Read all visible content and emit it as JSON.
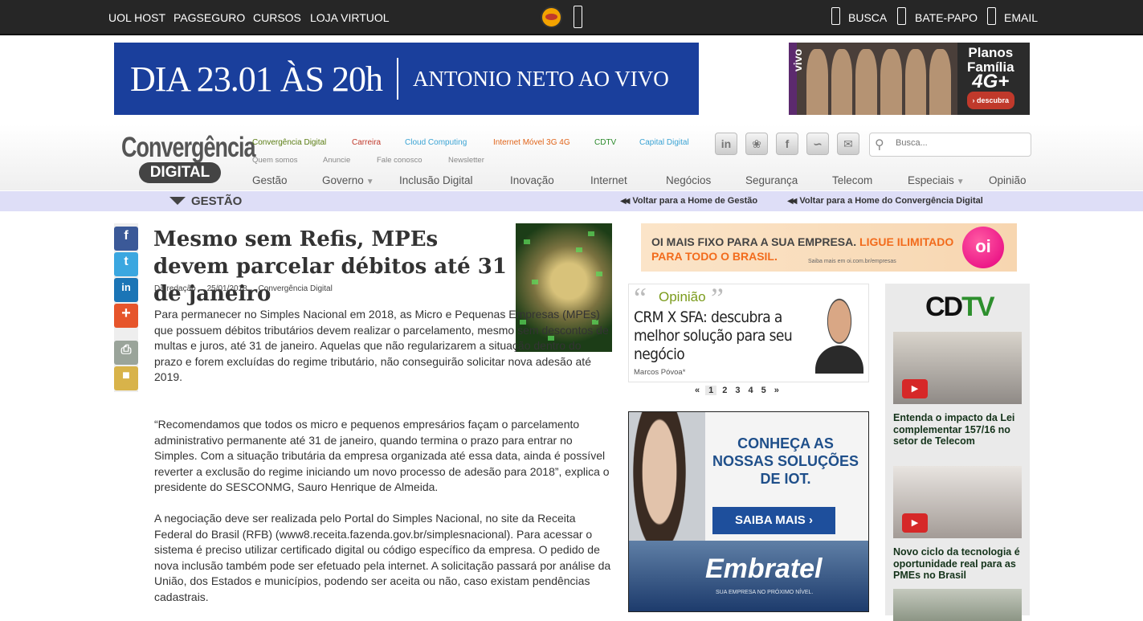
{
  "topbar": {
    "links": [
      "UOL HOST",
      "PAGSEGURO",
      "CURSOS",
      "LOJA VIRTUOL"
    ],
    "right": [
      "BUSCA",
      "BATE-PAPO",
      "EMAIL"
    ]
  },
  "ads": {
    "top_left_a": "DIA 23.01 ÀS 20h",
    "top_left_b": "ANTONIO NETO AO VIVO",
    "vivo_brand": "vivo",
    "vivo_line1": "Planos",
    "vivo_line2": "Família",
    "vivo_line3": "4G+",
    "vivo_cta": "› descubra"
  },
  "header": {
    "logo_line1": "Convergência",
    "logo_line2": "DIGITAL",
    "sites": [
      {
        "label": "Convergência Digital",
        "color": "#5a7d13"
      },
      {
        "label": "Carreira",
        "color": "#c0392b"
      },
      {
        "label": "Cloud Computing",
        "color": "#3aa3d4"
      },
      {
        "label": "Internet Móvel 3G 4G",
        "color": "#e0641a"
      },
      {
        "label": "CDTV",
        "color": "#2b8a2b"
      },
      {
        "label": "Capital Digital",
        "color": "#3aa3d4"
      }
    ],
    "sublinks": [
      "Quem somos",
      "Anuncie",
      "Fale conosco",
      "Newsletter"
    ],
    "social_icons": [
      "linkedin-icon",
      "twitter-icon",
      "facebook-icon",
      "rss-icon",
      "mail-icon"
    ],
    "search_placeholder": "Busca...",
    "nav": [
      "Gestão",
      "Governo",
      "Inclusão Digital",
      "Inovação",
      "Internet",
      "Negócios",
      "Segurança",
      "Telecom",
      "Especiais",
      "Opinião"
    ]
  },
  "section": {
    "title": "GESTÃO",
    "back_home_section": "Voltar para a Home de Gestão",
    "back_home_site": "Voltar para a Home do Convergência Digital"
  },
  "article": {
    "title": "Mesmo sem Refis, MPEs devem parcelar débitos até 31 de janeiro",
    "meta": "Da redação ... 25/01/2018 ... Convergência Digital",
    "paragraphs": [
      "Para permanecer no Simples Nacional em 2018, as Micro e Pequenas Empresas (MPEs) que possuem débitos tributários devem realizar o parcelamento, mesmo sem descontos de multas e juros, até 31 de janeiro. Aquelas que não regularizarem a situação dentro do prazo e forem excluídas do regime tributário, não conseguirão solicitar nova adesão até 2019.",
      "“Recomendamos que todos os micro e pequenos empresários façam o parcelamento administrativo permanente até 31 de janeiro, quando termina o prazo para entrar no Simples. Com a situação tributária da empresa organizada até essa data, ainda é possível reverter a exclusão do regime iniciando um novo processo de adesão para 2018”, explica o presidente do SESCONMG, Sauro Henrique de Almeida.",
      "A negociação deve ser realizada pelo Portal do Simples Nacional, no site da Receita Federal do Brasil (RFB) (www8.receita.fazenda.gov.br/simplesnacional). Para acessar o sistema é preciso utilizar certificado digital ou código específico da empresa. O pedido de nova inclusão também pode ser efetuado pela internet. A solicitação passará por análise da União, dos Estados e municípios, podendo ser aceita ou não, caso existam pendências cadastrais."
    ]
  },
  "oi_ad": {
    "line1a": "OI MAIS FIXO PARA A SUA EMPRESA.",
    "line1b": "LIGUE ILIMITADO",
    "line2": "PARA TODO O BRASIL.",
    "small": "Saiba mais em oi.com.br/empresas",
    "logo": "oi"
  },
  "opinion": {
    "label": "Opinião",
    "title": "CRM X SFA: descubra a melhor solução para seu negócio",
    "author": "Marcos Póvoa*",
    "pager": [
      "«",
      "1",
      "2",
      "3",
      "4",
      "5",
      "»"
    ]
  },
  "embratel_ad": {
    "headline_1": "CONHEÇA AS",
    "headline_2": "NOSSAS SOLUÇÕES",
    "headline_3": "DE IOT.",
    "cta": "SAIBA MAIS ›",
    "brand": "Embratel",
    "tagline": "SUA EMPRESA NO PRÓXIMO NÍVEL."
  },
  "cdtv": {
    "logo_a": "CD",
    "logo_b": "TV",
    "videos": [
      "Entenda o impacto da Lei complementar 157/16 no setor de Telecom",
      "Novo ciclo da tecnologia é oportunidade real para as PMEs no Brasil"
    ]
  }
}
